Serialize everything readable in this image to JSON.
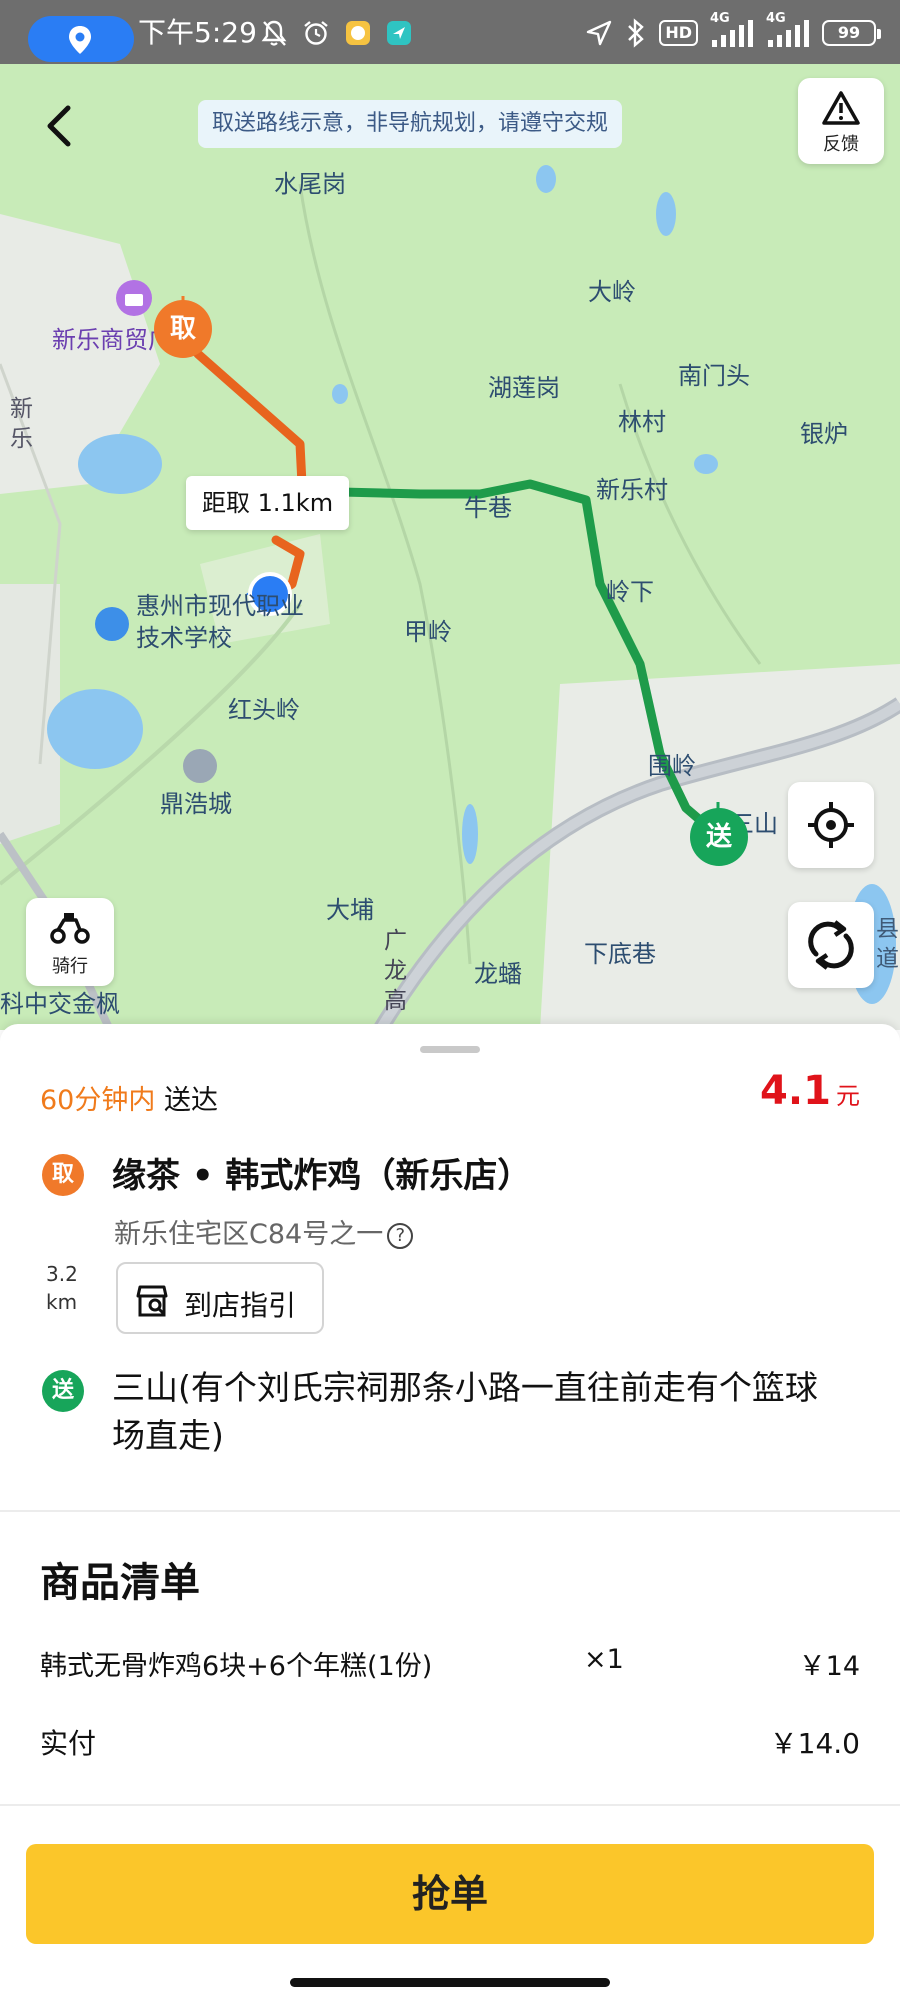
{
  "status_bar": {
    "time": "下午5:29",
    "hd": "HD",
    "net1": "4G",
    "net2": "4G",
    "battery": "99"
  },
  "map": {
    "notice": "取送路线示意，非导航规划，请遵守交规",
    "feedback_label": "反馈",
    "ride_label": "骑行",
    "distance_tag": "距取 1.1km",
    "pickup_pin": "取",
    "dropoff_pin": "送",
    "labels": {
      "shuiweigang": "水尾岗",
      "xinle_plaza": "新乐商贸广场",
      "xinle_road": "新乐",
      "daling": "大岭",
      "nanmentou": "南门头",
      "hulianggang": "湖莲岗",
      "linchun": "林村",
      "yinlu": "银炉",
      "niuxiang": "牛巷",
      "xinlecun": "新乐村",
      "lingxia": "岭下",
      "jialing": "甲岭",
      "school": "惠州市现代职业技术学校",
      "hongtouling": "红头岭",
      "weiling": "围岭",
      "sanshan": "三山",
      "dinghaocheng": "鼎浩城",
      "dabu": "大埔",
      "guanglong": "广龙高",
      "longfan": "龙蟠",
      "xiadiwei": "下底巷",
      "kejiao": "科中交金枫",
      "road_right": "县道"
    },
    "colors": {
      "land": "#c8ebb8",
      "route_pickup": "#e8641e",
      "route_delivery": "#1e9b4a",
      "accent_blue": "#2a7df4"
    }
  },
  "order": {
    "eta_highlight": "60分钟内",
    "eta_suffix": "送达",
    "price_num": "4.1",
    "price_unit": "元",
    "pickup_badge": "取",
    "shop_name": "缘茶 • 韩式炸鸡（新乐店）",
    "shop_address": "新乐住宅区C84号之一",
    "help_icon": "?",
    "distance_value": "3.2",
    "distance_unit": "km",
    "guide_button": "到店指引",
    "delivery_badge": "送",
    "destination": "三山(有个刘氏宗祠那条小路一直往前走有个篮球场直走)"
  },
  "goods": {
    "title": "商品清单",
    "items": [
      {
        "name": "韩式无骨炸鸡6块+6个年糕(1份)",
        "qty": "×1",
        "price": "￥14"
      }
    ],
    "paid_label": "实付",
    "paid_value": "￥14.0"
  },
  "action": {
    "grab_button": "抢单"
  }
}
